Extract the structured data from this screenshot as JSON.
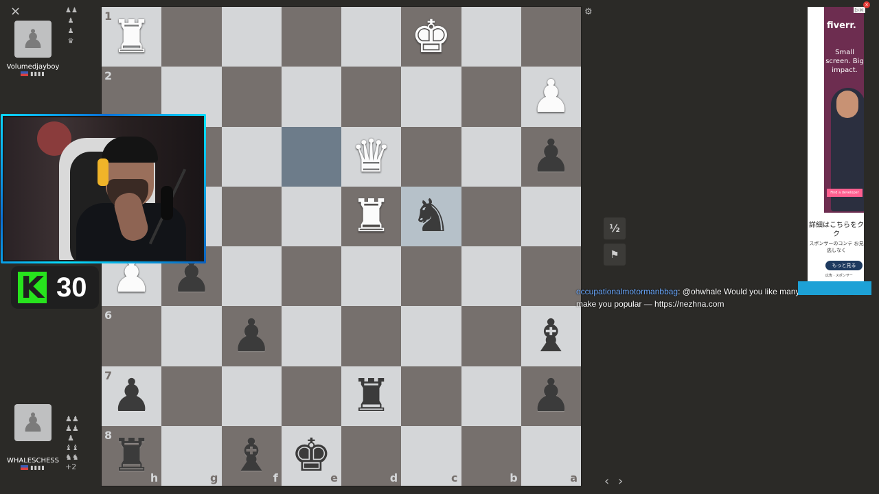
{
  "board": {
    "ranks": [
      "1",
      "2",
      "3",
      "4",
      "5",
      "6",
      "7",
      "8"
    ],
    "files": [
      "h",
      "g",
      "f",
      "e",
      "d",
      "c",
      "b",
      "a"
    ],
    "highlight": [
      "e3",
      "c4"
    ],
    "pieces": [
      {
        "sq": "h1",
        "glyph": "♜",
        "color": "w",
        "name": "white-rook"
      },
      {
        "sq": "c1",
        "glyph": "♚",
        "color": "w",
        "name": "white-king"
      },
      {
        "sq": "a2",
        "glyph": "♟",
        "color": "w",
        "name": "white-pawn"
      },
      {
        "sq": "d3",
        "glyph": "♛",
        "color": "w",
        "name": "white-queen"
      },
      {
        "sq": "a3",
        "glyph": "♟",
        "color": "b",
        "name": "black-pawn"
      },
      {
        "sq": "d4",
        "glyph": "♜",
        "color": "w",
        "name": "white-rook"
      },
      {
        "sq": "c4",
        "glyph": "♞",
        "color": "b",
        "name": "black-knight"
      },
      {
        "sq": "h5",
        "glyph": "♟",
        "color": "w",
        "name": "white-pawn"
      },
      {
        "sq": "g5",
        "glyph": "♟",
        "color": "b",
        "name": "black-pawn"
      },
      {
        "sq": "f6",
        "glyph": "♟",
        "color": "b",
        "name": "black-pawn"
      },
      {
        "sq": "a6",
        "glyph": "♝",
        "color": "b",
        "name": "black-bishop"
      },
      {
        "sq": "h7",
        "glyph": "♟",
        "color": "b",
        "name": "black-pawn"
      },
      {
        "sq": "d7",
        "glyph": "♜",
        "color": "b",
        "name": "black-rook"
      },
      {
        "sq": "a7",
        "glyph": "♟",
        "color": "b",
        "name": "black-pawn"
      },
      {
        "sq": "h8",
        "glyph": "♜",
        "color": "b",
        "name": "black-rook"
      },
      {
        "sq": "f8",
        "glyph": "♝",
        "color": "b",
        "name": "black-bishop"
      },
      {
        "sq": "e8",
        "glyph": "♚",
        "color": "b",
        "name": "black-king"
      }
    ]
  },
  "top_player": {
    "name": "Volumedjayboy",
    "captured": [
      "♟♟",
      "♟",
      "♟",
      "♛"
    ]
  },
  "bottom_player": {
    "name": "WHALESCHESS",
    "captured": [
      "♟♟",
      "♟♟",
      "♟",
      "♝♝",
      "♞♞"
    ],
    "captured_extra": "+2"
  },
  "kick": {
    "count": "30",
    "logo_letter": "K",
    "color": "#27e31d"
  },
  "controls": {
    "draw_label": "½",
    "resign_icon": "⚑",
    "settings_icon": "⚙",
    "prev": "‹",
    "next": "›",
    "close": "×"
  },
  "chat": {
    "user": "occupationalmotormanbbag",
    "message": ": @ohwhale Would you like many viewers? Let's make you popular — https://nezhna.com"
  },
  "ad": {
    "brand": "fiverr.",
    "tagline": "Small screen. Big impact.",
    "cta": "Find a developer",
    "jp_headline": "詳細はこちらをク ク",
    "jp_body": "スポンサーのコンテ お見逃しなく",
    "more_button": "もっと見る",
    "footer": "広告 · スポンサー"
  },
  "colors": {
    "light_square": "#d4d6d8",
    "dark_square": "#76706d",
    "highlight": "#b6c1c9",
    "background": "#2b2a27",
    "chat_user": "#6aa9ff"
  }
}
